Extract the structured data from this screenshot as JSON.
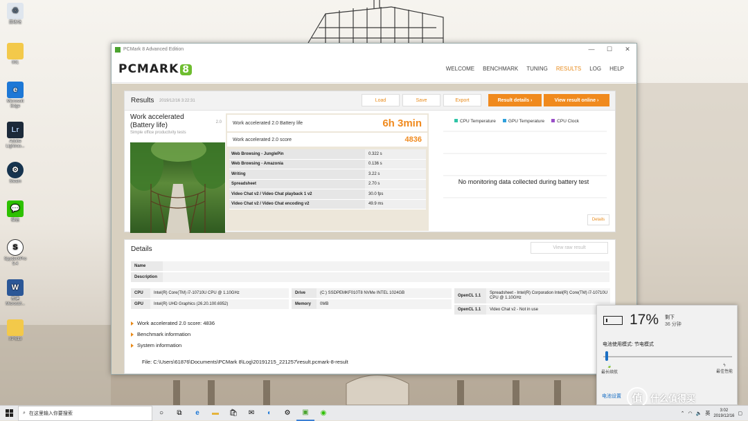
{
  "desktop": {
    "icons": [
      {
        "label": "回收站",
        "icon": "recycle-bin-icon"
      },
      {
        "label": "001",
        "icon": "folder-icon"
      },
      {
        "label": "Microsoft Edge",
        "icon": "edge-icon"
      },
      {
        "label": "Adobe Lightroo...",
        "icon": "lightroom-icon",
        "glyph": "Lr"
      },
      {
        "label": "Steam",
        "icon": "steam-icon"
      },
      {
        "label": "微信",
        "icon": "wechat-icon"
      },
      {
        "label": "SpyderXPro 5.4",
        "icon": "spyder-icon",
        "glyph": "S"
      },
      {
        "label": "新建 Microsof...",
        "icon": "word-icon",
        "glyph": "W"
      },
      {
        "label": "XPS13",
        "icon": "folder-icon"
      }
    ]
  },
  "window": {
    "title": "PCMark 8 Advanced Edition",
    "logo_text": "PCMARK",
    "logo_num": "8",
    "nav": [
      "WELCOME",
      "BENCHMARK",
      "TUNING",
      "RESULTS",
      "LOG",
      "HELP"
    ],
    "nav_active": "RESULTS"
  },
  "results": {
    "title": "Results",
    "date": "2019/12/16 3:22:31",
    "buttons": {
      "load": "Load",
      "save": "Save",
      "export": "Export",
      "details": "Result details",
      "online": "View result online"
    },
    "test_name": "Work accelerated (Battery life)",
    "test_version": "2.0",
    "test_subtitle": "Simple office productivity tests",
    "battery_label": "Work accelerated 2.0 Battery life",
    "battery_value": "6h 3min",
    "score_label": "Work accelerated 2.0 score",
    "score_value": "4836",
    "subtests": [
      {
        "name": "Web Browsing - JunglePin",
        "value": "0.322 s"
      },
      {
        "name": "Web Browsing - Amazonia",
        "value": "0.136 s"
      },
      {
        "name": "Writing",
        "value": "3.22 s"
      },
      {
        "name": "Spreadsheet",
        "value": "2.70 s"
      },
      {
        "name": "Video Chat v2 / Video Chat playback 1 v2",
        "value": "30.0 fps"
      },
      {
        "name": "Video Chat v2 / Video Chat encoding v2",
        "value": "49.9 ms"
      }
    ],
    "legend": [
      {
        "label": "CPU Temperature",
        "color": "#2ec4a6"
      },
      {
        "label": "GPU Temperature",
        "color": "#2fa0dc"
      },
      {
        "label": "CPU Clock",
        "color": "#9a4fc8"
      }
    ],
    "no_monitoring": "No monitoring data collected during battery test",
    "monitor_details": "Details"
  },
  "details": {
    "title": "Details",
    "raw_button": "View raw result",
    "name_label": "Name",
    "description_label": "Description",
    "cpu_label": "CPU",
    "cpu_value": "Intel(R) Core(TM) i7-10710U CPU @ 1.10GHz",
    "gpu_label": "GPU",
    "gpu_value": "Intel(R) UHD Graphics (26.20.100.6952)",
    "drive_label": "Drive",
    "drive_value": "(C:) SSDPEMKF010T8 NVMe INTEL 1024GB",
    "memory_label": "Memory",
    "memory_value": "0MB",
    "opencl1_label": "OpenCL 1.1",
    "opencl1_value": "Spreadsheet - Intel(R) Corporation Intel(R) Core(TM) i7-10710U CPU @ 1.10GHz",
    "opencl2_label": "OpenCL 1.1",
    "opencl2_value": "Video Chat v2 - Not in use",
    "expanders": [
      "Work accelerated 2.0 score: 4836",
      "Benchmark information",
      "System information"
    ],
    "file": "File: C:\\Users\\61876\\Documents\\PCMark 8\\Log\\20191215_221257\\result.pcmark-8-result"
  },
  "battery": {
    "percent": "17%",
    "remaining_label": "剩下",
    "remaining_time": "36 分钟",
    "mode": "电池使用模式: 节电模式",
    "slider_level": 0.02,
    "left_label": "最长续航",
    "right_label": "最佳性能",
    "settings": "电池设置"
  },
  "taskbar": {
    "search_placeholder": "在这里输入你要搜索",
    "tray_lang": "英",
    "time": "3:02",
    "date": "2019/12/16"
  },
  "watermark": {
    "glyph": "值",
    "text": "什么值得买"
  }
}
